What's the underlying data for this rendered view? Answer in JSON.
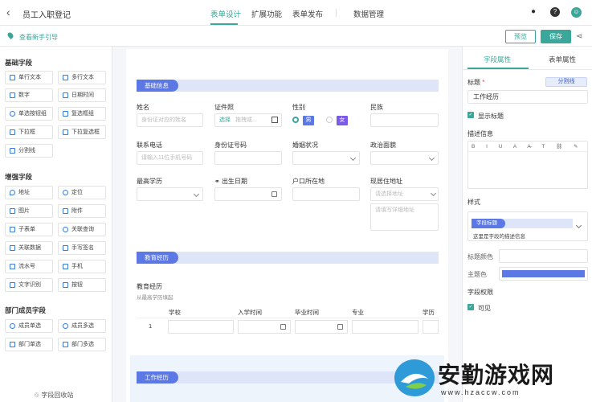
{
  "header": {
    "back_icon": "chevron-left-icon",
    "title": "员工入职登记",
    "tabs": [
      {
        "label": "表单设计",
        "active": true
      },
      {
        "label": "扩展功能",
        "active": false
      },
      {
        "label": "表单发布",
        "active": false
      },
      {
        "label": "数据管理",
        "active": false
      }
    ],
    "icons": [
      "bell-icon",
      "help-icon",
      "avatar"
    ]
  },
  "subbar": {
    "guide_text": "查看新手引导",
    "preview_label": "预览",
    "save_label": "保存",
    "share_icon": "share-icon"
  },
  "left_panel": {
    "sections": [
      {
        "title": "基础字段",
        "items": [
          "单行文本",
          "多行文本",
          "数字",
          "日期时间",
          "单选按钮组",
          "复选框组",
          "下拉框",
          "下拉复选框",
          "分割线"
        ]
      },
      {
        "title": "增强字段",
        "items": [
          "地址",
          "定位",
          "图片",
          "附件",
          "子表单",
          "关联查询",
          "关联数据",
          "手写签名",
          "流水号",
          "手机",
          "文字识别",
          "按钮"
        ]
      },
      {
        "title": "部门成员字段",
        "items": [
          "成员单选",
          "成员多选",
          "部门单选",
          "部门多选"
        ]
      }
    ],
    "recycle_label": "字段回收站"
  },
  "form": {
    "sections": [
      {
        "title": "基础信息"
      },
      {
        "title": "教育经历"
      },
      {
        "title": "工作经历"
      }
    ],
    "fields": {
      "name": {
        "label": "姓名",
        "placeholder": "身份证对应的姓名"
      },
      "id_type": {
        "label": "证件照",
        "select_text": "选择",
        "placeholder": "拖拽或..."
      },
      "gender": {
        "label": "性别",
        "male": "男",
        "female": "女",
        "male_color": "#5b78e5",
        "female_color": "#7b5be5"
      },
      "ethnicity": {
        "label": "民族"
      },
      "phone": {
        "label": "联系电话",
        "placeholder": "请输入11位手机号码"
      },
      "id_number": {
        "label": "身份证号码"
      },
      "marital": {
        "label": "婚姻状况"
      },
      "political": {
        "label": "政治面貌"
      },
      "education": {
        "label": "最高学历"
      },
      "birthdate": {
        "label": "出生日期"
      },
      "hukou": {
        "label": "户口所在地"
      },
      "address": {
        "label": "现居住地址",
        "region_placeholder": "请选择地址",
        "detail_placeholder": "请填写详细地址"
      }
    },
    "edu_table": {
      "label": "教育经历",
      "hint": "从最高学历填起",
      "columns": [
        "学校",
        "入学时间",
        "毕业时间",
        "专业",
        "学历"
      ],
      "row_number": "1"
    }
  },
  "right_panel": {
    "tabs": [
      {
        "label": "字段属性",
        "active": true
      },
      {
        "label": "表单属性",
        "active": false
      }
    ],
    "title_label": "标题",
    "required_mark": "*",
    "divider_button": "分割线",
    "title_value": "工作经历",
    "show_title_label": "显示标题",
    "desc_label": "描述信息",
    "editor_tools": "B I U A A̶ T ⛓ ✎ ▣",
    "style_label": "样式",
    "style_tag": "字段标题",
    "style_desc": "这里是字段的描述信息",
    "title_color_label": "标题颜色",
    "theme_color_label": "主题色",
    "theme_color": "#5b78e5",
    "permission_label": "字段权限",
    "visible_label": "可见"
  },
  "watermark": {
    "text": "安勤游戏网",
    "url": "www.hzaccw.com"
  },
  "colors": {
    "accent": "#3aa79a",
    "section": "#5b78e5"
  }
}
